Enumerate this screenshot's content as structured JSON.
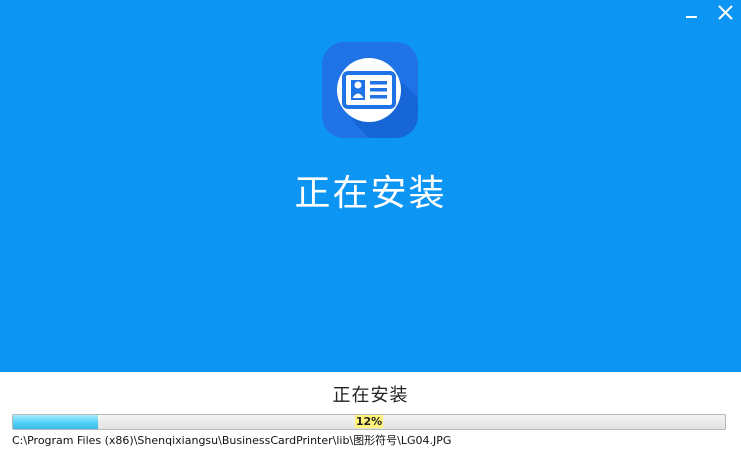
{
  "window": {
    "minimize_icon": "minimize-icon",
    "close_icon": "close-icon"
  },
  "hero": {
    "background_color": "#0d95f3",
    "app_icon": "business-card-icon",
    "title": "正在安装"
  },
  "footer": {
    "status_label": "正在安装",
    "progress": {
      "value": 0.12,
      "label": "12%"
    },
    "current_file": "C:\\Program Files (x86)\\Shenqixiangsu\\BusinessCardPrinter\\lib\\图形符号\\LG04.JPG"
  }
}
